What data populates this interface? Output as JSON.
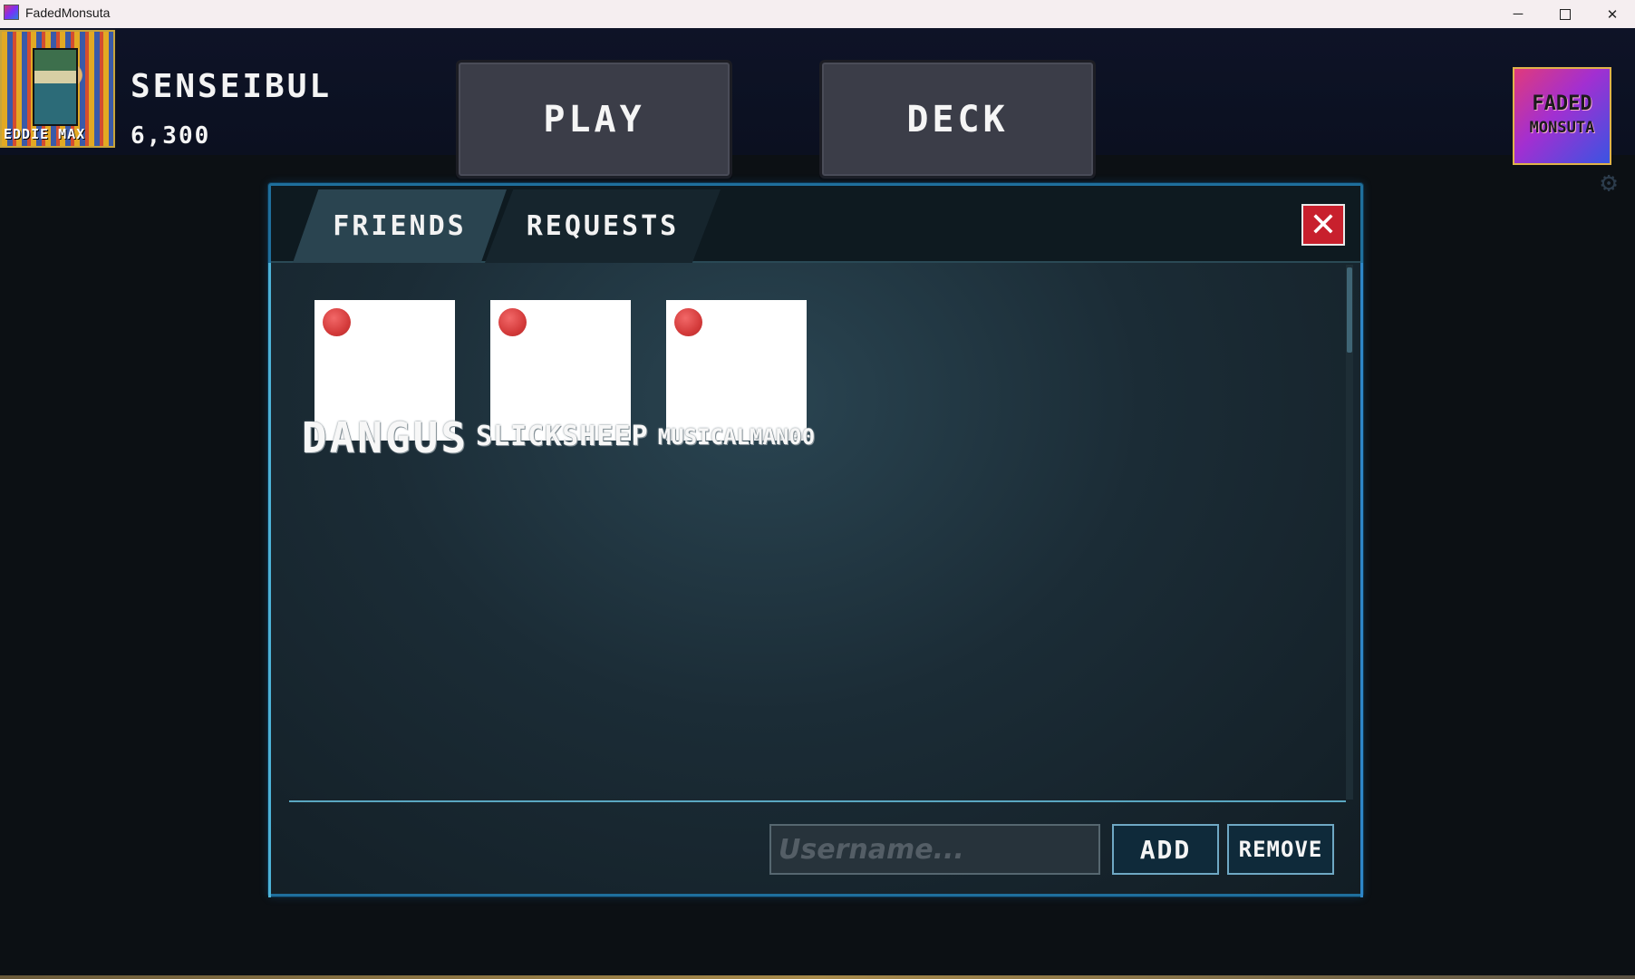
{
  "window": {
    "title": "FadedMonsuta",
    "minimize": "─",
    "close": "✕"
  },
  "header": {
    "avatar_tag": "EDDIE MAX",
    "username": "SENSEIBUL",
    "coins": "6,300",
    "play_label": "PLAY",
    "deck_label": "DECK",
    "logo_line1": "FADED",
    "logo_line2": "MONSUTA",
    "settings_icon": "gear-icon"
  },
  "friends_panel": {
    "tabs": [
      {
        "label": "FRIENDS",
        "active": true
      },
      {
        "label": "REQUESTS",
        "active": false
      }
    ],
    "close_icon": "✕",
    "friends": [
      {
        "name": "DANGUS",
        "status": "offline"
      },
      {
        "name": "SLICKSHEEP",
        "status": "offline"
      },
      {
        "name": "MUSICALMAN00",
        "status": "offline"
      }
    ],
    "username_placeholder": "Username...",
    "add_label": "ADD",
    "remove_label": "REMOVE"
  },
  "colors": {
    "status_offline": "#d43b3b",
    "panel_border": "#4db2d7",
    "close_button": "#c8202d"
  }
}
